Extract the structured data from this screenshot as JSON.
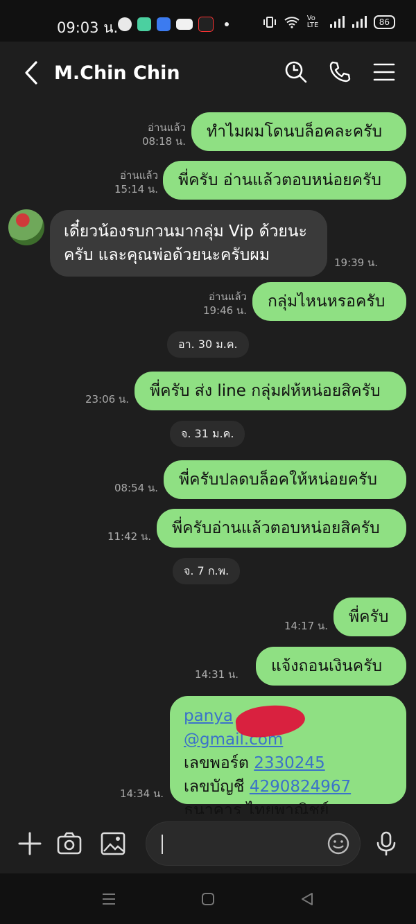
{
  "status_bar": {
    "time": "09:03 น.",
    "battery": "86",
    "network": "Vo LTE"
  },
  "header": {
    "title": "M.Chin Chin"
  },
  "messages": [
    {
      "text": "ทำไมผมโดนบล็อคละครับ",
      "read": "อ่านแล้ว",
      "time": "08:18 น."
    },
    {
      "text": "พี่ครับ อ่านแล้วตอบหน่อยครับ",
      "read": "อ่านแล้ว",
      "time": "15:14 น."
    },
    {
      "text": "เดี๋ยวน้องรบกวนมากลุ่ม Vip ด้วยนะครับ และคุณพ่อด้วยนะครับผม",
      "time": "19:39 น."
    },
    {
      "text": "กลุ่มไหนหรอครับ",
      "read": "อ่านแล้ว",
      "time": "19:46 น."
    },
    {
      "text": "พี่ครับ ส่ง line กลุ่มฝห้หน่อยสิครับ",
      "time": "23:06 น."
    },
    {
      "text": "พี่ครับปลดบล็อคให้หน่อยครับ",
      "time": "08:54 น."
    },
    {
      "text": "พี่ครับอ่านแล้วตอบหน่อยสิครับ",
      "time": "11:42 น."
    },
    {
      "text": "พี่ครับ",
      "time": "14:17 น."
    },
    {
      "text": "แจ้งถอนเงินครับ",
      "time": "14:31 น."
    }
  ],
  "dates": [
    "อา. 30 ม.ค.",
    "จ. 31 ม.ค.",
    "จ. 7 ก.พ."
  ],
  "last_message": {
    "email_start": "panya",
    "email_end": "@gmail.com",
    "line2_label": "เลขพอร์ต",
    "line2_value": "2330245",
    "line3_label": "เลขบัญชี",
    "line3_value": "4290824967",
    "line4": "ธนาคาร ไทยพาณิชย์",
    "time": "14:34 น."
  },
  "colors": {
    "outgoing_bubble": "#8fe083",
    "incoming_bubble": "#3a3a3a",
    "background": "#1e1e1e",
    "link": "#3b72c9"
  }
}
